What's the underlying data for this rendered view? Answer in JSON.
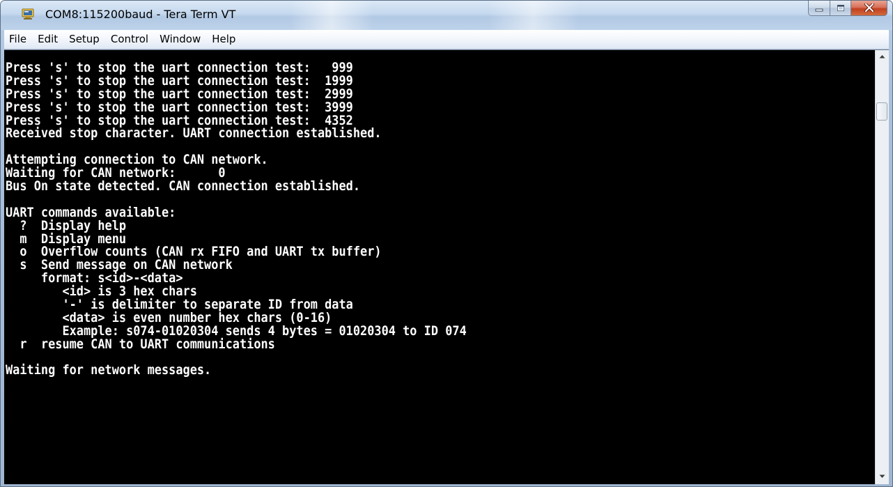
{
  "window": {
    "title": "COM8:115200baud - Tera Term VT"
  },
  "icons": {
    "app": "tera-term-icon",
    "minimize": "minimize-icon",
    "maximize": "maximize-icon",
    "close": "close-icon"
  },
  "menu": {
    "items": [
      {
        "label": "File"
      },
      {
        "label": "Edit"
      },
      {
        "label": "Setup"
      },
      {
        "label": "Control"
      },
      {
        "label": "Window"
      },
      {
        "label": "Help"
      }
    ]
  },
  "terminal": {
    "lines": [
      "Press 's' to stop the uart connection test:   999",
      "Press 's' to stop the uart connection test:  1999",
      "Press 's' to stop the uart connection test:  2999",
      "Press 's' to stop the uart connection test:  3999",
      "Press 's' to stop the uart connection test:  4352",
      "Received stop character. UART connection established.",
      "",
      "Attempting connection to CAN network.",
      "Waiting for CAN network:      0",
      "Bus On state detected. CAN connection established.",
      "",
      "UART commands available:",
      "  ?  Display help",
      "  m  Display menu",
      "  o  Overflow counts (CAN rx FIFO and UART tx buffer)",
      "  s  Send message on CAN network",
      "     format: s<id>-<data>",
      "        <id> is 3 hex chars",
      "        '-' is delimiter to separate ID from data",
      "        <data> is even number hex chars (0-16)",
      "        Example: s074-01020304 sends 4 bytes = 01020304 to ID 074",
      "  r  resume CAN to UART communications",
      "",
      "Waiting for network messages."
    ]
  },
  "colors": {
    "terminal_bg": "#000000",
    "terminal_fg": "#ffffff",
    "close_button": "#c7432a"
  }
}
